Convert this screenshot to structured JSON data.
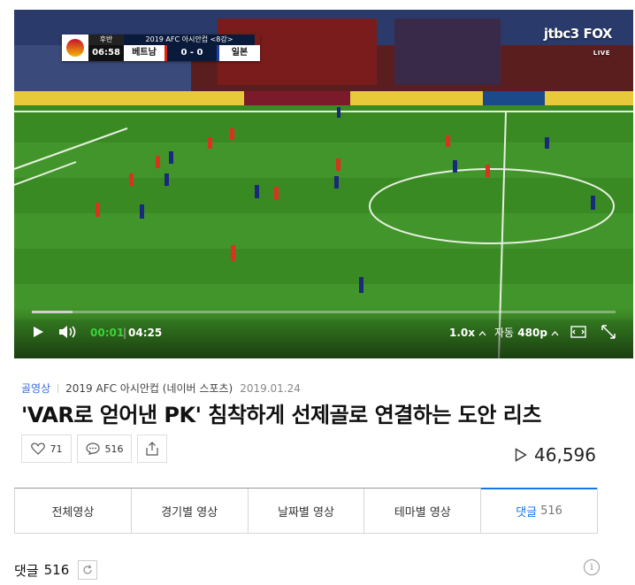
{
  "player": {
    "scorebug": {
      "half": "후반",
      "competition": "2019 AFC 아시안컵 <8강>",
      "clock": "06:58",
      "team_home": "베트남",
      "score": "0 - 0",
      "team_away": "일본"
    },
    "broadcaster": "jtbc3 FOX",
    "live_tag": "LIVE",
    "progress": 0.07,
    "time_current": "00:01",
    "time_separator": "|",
    "time_total": "04:25",
    "speed": "1.0x",
    "quality_mode": "자동",
    "quality": "480p",
    "icons": [
      "play-icon",
      "volume-icon",
      "pip-icon",
      "fullscreen-icon"
    ]
  },
  "meta": {
    "category": "골영상",
    "league": "2019 AFC 아시안컵 (네이버 스포츠)",
    "date": "2019.01.24"
  },
  "title": "'VAR로 얻어낸 PK' 침착하게 선제골로 연결하는 도안 리츠",
  "actions": {
    "like_count": "71",
    "comment_count": "516"
  },
  "views": "46,596",
  "tabs": [
    {
      "label": "전체영상"
    },
    {
      "label": "경기별 영상"
    },
    {
      "label": "날짜별 영상"
    },
    {
      "label": "테마별 영상"
    },
    {
      "label": "댓글",
      "count": "516"
    }
  ],
  "comments": {
    "label": "댓글",
    "count": "516"
  },
  "colors": {
    "accent": "#1a73e8",
    "time_current": "#3cd43c",
    "category": "#3a6ad8"
  }
}
